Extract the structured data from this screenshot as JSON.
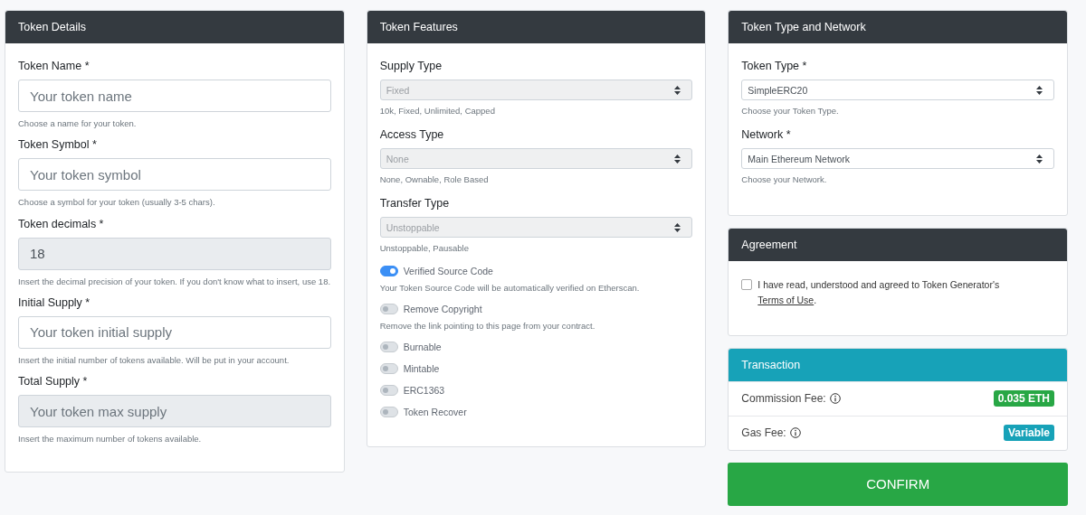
{
  "details": {
    "title": "Token Details",
    "fields": [
      {
        "label": "Token Name *",
        "placeholder": "Your token name",
        "disabled": false,
        "help": "Choose a name for your token."
      },
      {
        "label": "Token Symbol *",
        "placeholder": "Your token symbol",
        "disabled": false,
        "help": "Choose a symbol for your token (usually 3-5 chars)."
      },
      {
        "label": "Token decimals *",
        "value": "18",
        "disabled": true,
        "help": "Insert the decimal precision of your token. If you don't know what to insert, use 18."
      },
      {
        "label": "Initial Supply *",
        "placeholder": "Your token initial supply",
        "disabled": false,
        "help": "Insert the initial number of tokens available. Will be put in your account."
      },
      {
        "label": "Total Supply *",
        "placeholder": "Your token max supply",
        "disabled": true,
        "help": "Insert the maximum number of tokens available."
      }
    ]
  },
  "features": {
    "title": "Token Features",
    "selects": [
      {
        "label": "Supply Type",
        "value": "Fixed",
        "disabled": true,
        "help": "10k, Fixed, Unlimited, Capped"
      },
      {
        "label": "Access Type",
        "value": "None",
        "disabled": true,
        "help": "None, Ownable, Role Based"
      },
      {
        "label": "Transfer Type",
        "value": "Unstoppable",
        "disabled": true,
        "help": "Unstoppable, Pausable"
      }
    ],
    "toggles": [
      {
        "label": "Verified Source Code",
        "on": true,
        "help": "Your Token Source Code will be automatically verified on Etherscan."
      },
      {
        "label": "Remove Copyright",
        "on": false,
        "help": "Remove the link pointing to this page from your contract."
      },
      {
        "label": "Burnable",
        "on": false
      },
      {
        "label": "Mintable",
        "on": false
      },
      {
        "label": "ERC1363",
        "on": false
      },
      {
        "label": "Token Recover",
        "on": false
      }
    ]
  },
  "network": {
    "title": "Token Type and Network",
    "selects": [
      {
        "label": "Token Type *",
        "value": "SimpleERC20",
        "disabled": false,
        "help": "Choose your Token Type."
      },
      {
        "label": "Network *",
        "value": "Main Ethereum Network",
        "disabled": false,
        "help": "Choose your Network."
      }
    ]
  },
  "agreement": {
    "title": "Agreement",
    "checked": false,
    "text": "I have read, understood and agreed to Token Generator's",
    "link": "Terms of Use",
    "after": "."
  },
  "transaction": {
    "title": "Transaction",
    "rows": [
      {
        "label": "Commission Fee:",
        "badge": "0.035 ETH",
        "color": "#28a745"
      },
      {
        "label": "Gas Fee:",
        "badge": "Variable",
        "color": "#17a2b8"
      }
    ]
  },
  "confirm": "CONFIRM"
}
